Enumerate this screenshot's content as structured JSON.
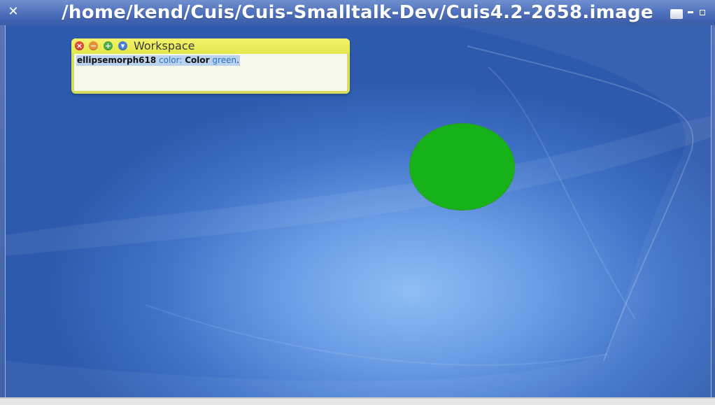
{
  "window": {
    "title": "/home/kend/Cuis/Cuis-Smalltalk-Dev/Cuis4.2-2658.image",
    "close_icon": "close-icon",
    "controls": [
      "maximize-icon",
      "minimize-icon",
      "restore-icon"
    ]
  },
  "workspace": {
    "title": "Workspace",
    "buttons": [
      "close-icon",
      "collapse-icon",
      "expand-icon",
      "menu-icon"
    ],
    "code": {
      "receiver": "ellipsemorph618",
      "keyword": "color:",
      "class_name": "Color",
      "selector": "green",
      "terminator": "."
    }
  },
  "morph": {
    "name": "ellipsemorph618",
    "shape": "ellipse",
    "color": "#17b11a"
  },
  "colors": {
    "workspace_header": "#e8ec56",
    "workspace_body": "#f5f7ea",
    "desktop": "#3f72c8",
    "selection": "#b9d3ee"
  }
}
